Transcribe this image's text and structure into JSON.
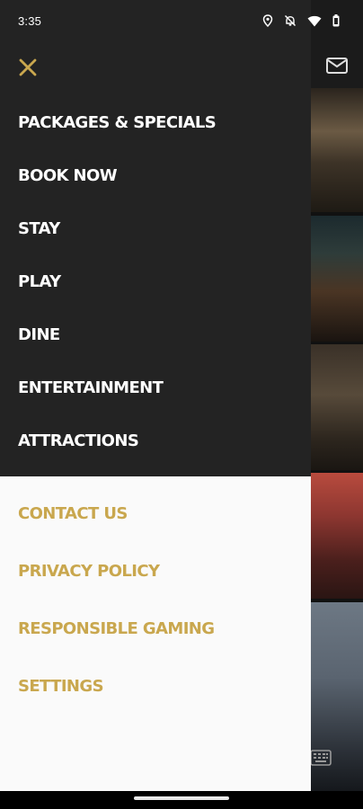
{
  "status_bar": {
    "time": "3:35",
    "icons": [
      "location-icon",
      "notifications-off-icon",
      "wifi-icon",
      "battery-icon"
    ]
  },
  "drawer": {
    "close_icon": "close-icon",
    "accent_color": "#c9a74e",
    "primary_menu": [
      {
        "label": "PACKAGES & SPECIALS"
      },
      {
        "label": "BOOK NOW"
      },
      {
        "label": "STAY"
      },
      {
        "label": "PLAY"
      },
      {
        "label": "DINE"
      },
      {
        "label": "ENTERTAINMENT"
      },
      {
        "label": "ATTRACTIONS"
      }
    ],
    "secondary_menu": [
      {
        "label": "CONTACT US"
      },
      {
        "label": "PRIVACY POLICY"
      },
      {
        "label": "RESPONSIBLE GAMING"
      },
      {
        "label": "SETTINGS"
      }
    ]
  },
  "background": {
    "header_icon": "mail-icon",
    "footer_icon": "keyboard-icon"
  }
}
